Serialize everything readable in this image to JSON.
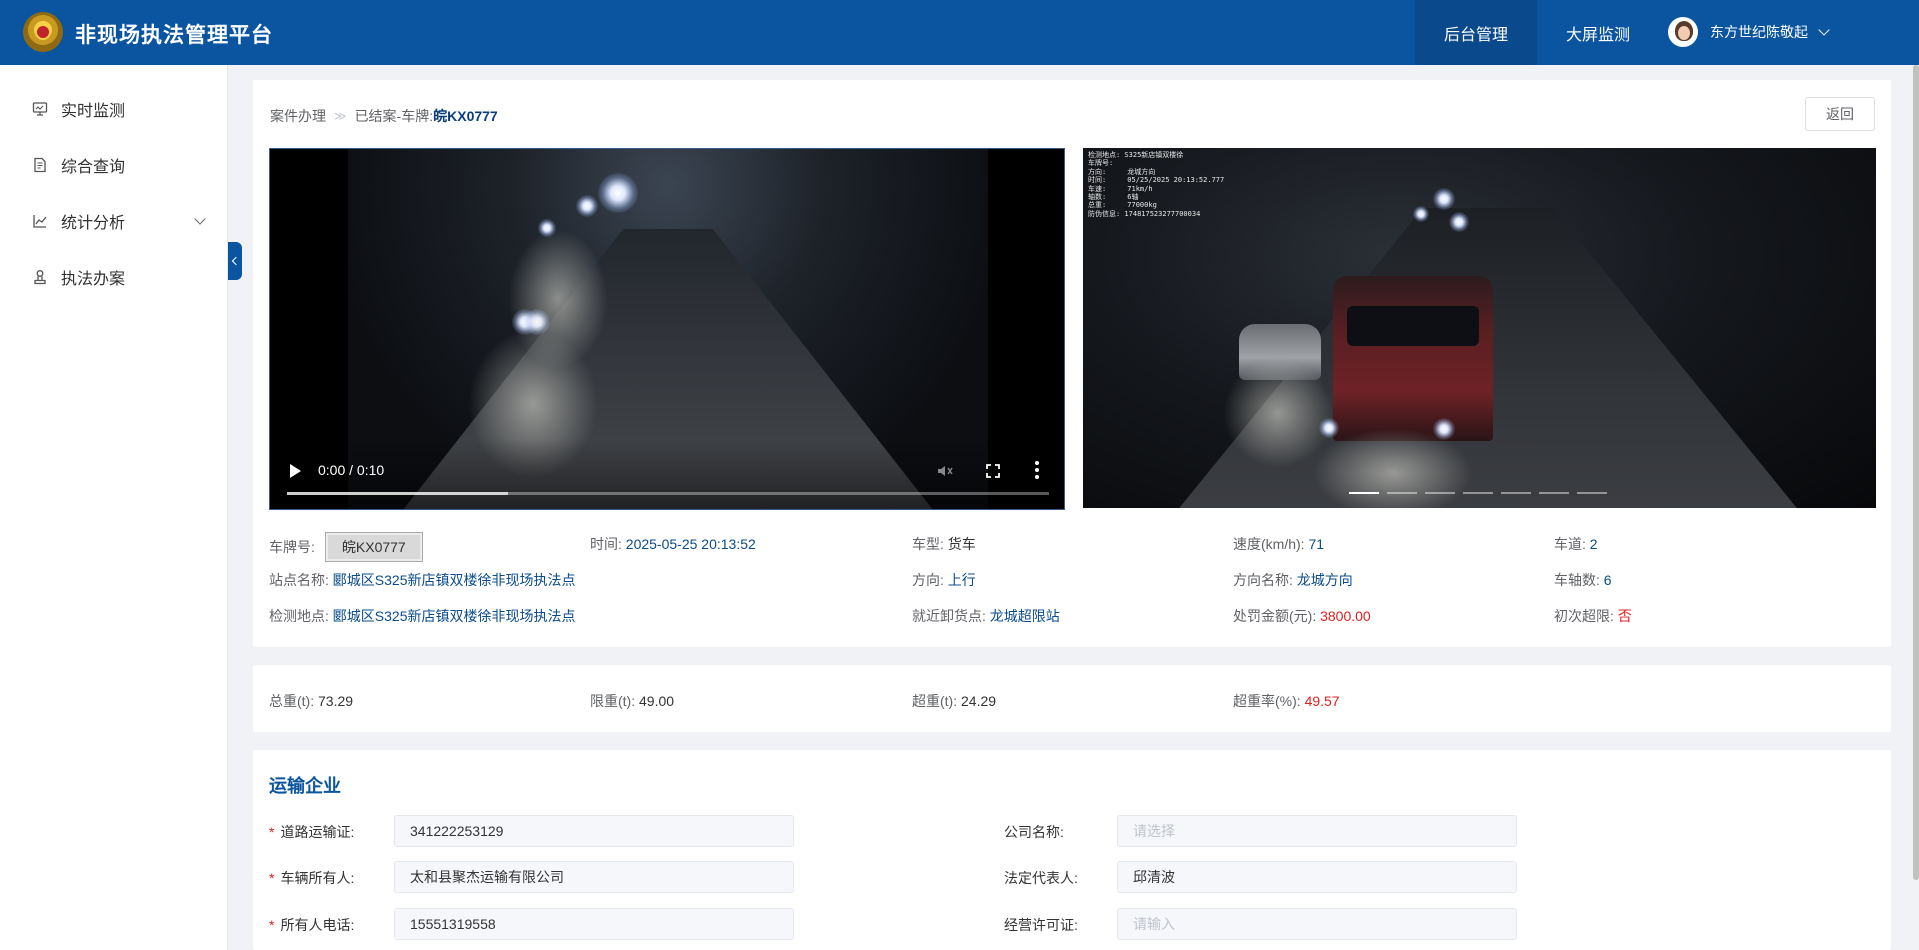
{
  "header": {
    "title": "非现场执法管理平台",
    "nav": [
      "后台管理",
      "大屏监测"
    ],
    "user": "东方世纪陈敬起"
  },
  "sidebar": {
    "items": [
      {
        "label": "实时监测",
        "icon": "monitor-icon"
      },
      {
        "label": "综合查询",
        "icon": "document-search-icon"
      },
      {
        "label": "统计分析",
        "icon": "line-chart-icon"
      },
      {
        "label": "执法办案",
        "icon": "stamp-icon"
      }
    ]
  },
  "breadcrumb": {
    "root": "案件办理",
    "current_prefix": "已结案-车牌:",
    "plate": "皖KX0777"
  },
  "buttons": {
    "back": "返回"
  },
  "video": {
    "time": "0:00 / 0:10",
    "buffered_fraction": 0.29
  },
  "photo": {
    "overlay_lines": [
      "检测地点: S325新店镇双楼徐",
      "车牌号:",
      "方向:     龙城方向",
      "时间:     05/25/2025 20:13:52.777",
      "车速:     71km/h",
      "轴数:     6轴",
      "总重:     77000kg",
      "防伪信息: 174817523277700034"
    ],
    "slide_count": 7,
    "active_slide": 0
  },
  "vehicle_info": {
    "plate_label": "车牌号:",
    "plate": "皖KX0777",
    "time_label": "时间:",
    "time": "2025-05-25 20:13:52",
    "type_label": "车型:",
    "type": "货车",
    "speed_label": "速度(km/h):",
    "speed": "71",
    "lane_label": "车道:",
    "lane": "2",
    "station_label": "站点名称:",
    "station": "郾城区S325新店镇双楼徐非现场执法点",
    "direction_label": "方向:",
    "direction": "上行",
    "direction_name_label": "方向名称:",
    "direction_name": "龙城方向",
    "axles_label": "车轴数:",
    "axles": "6",
    "detect_label": "检测地点:",
    "detect": "郾城区S325新店镇双楼徐非现场执法点",
    "unload_label": "就近卸货点:",
    "unload": "龙城超限站",
    "fine_label": "处罚金额(元):",
    "fine": "3800.00",
    "first_label": "初次超限:",
    "first": "否"
  },
  "weight": {
    "total_label": "总重(t):",
    "total": "73.29",
    "limit_label": "限重(t):",
    "limit": "49.00",
    "over_label": "超重(t):",
    "over": "24.29",
    "rate_label": "超重率(%):",
    "rate": "49.57"
  },
  "transport": {
    "title": "运输企业",
    "road_permit_label": "道路运输证:",
    "road_permit": "341222253129",
    "company_label": "公司名称:",
    "company_placeholder": "请选择",
    "owner_label": "车辆所有人:",
    "owner": "太和县聚杰运输有限公司",
    "legal_label": "法定代表人:",
    "legal": "邱清波",
    "phone_label": "所有人电话:",
    "phone": "15551319558",
    "license_label": "经营许可证:",
    "license_placeholder": "请输入"
  },
  "colors": {
    "brand": "#0b55a0",
    "value_blue": "#0b4c8c",
    "alert_red": "#e02020"
  }
}
